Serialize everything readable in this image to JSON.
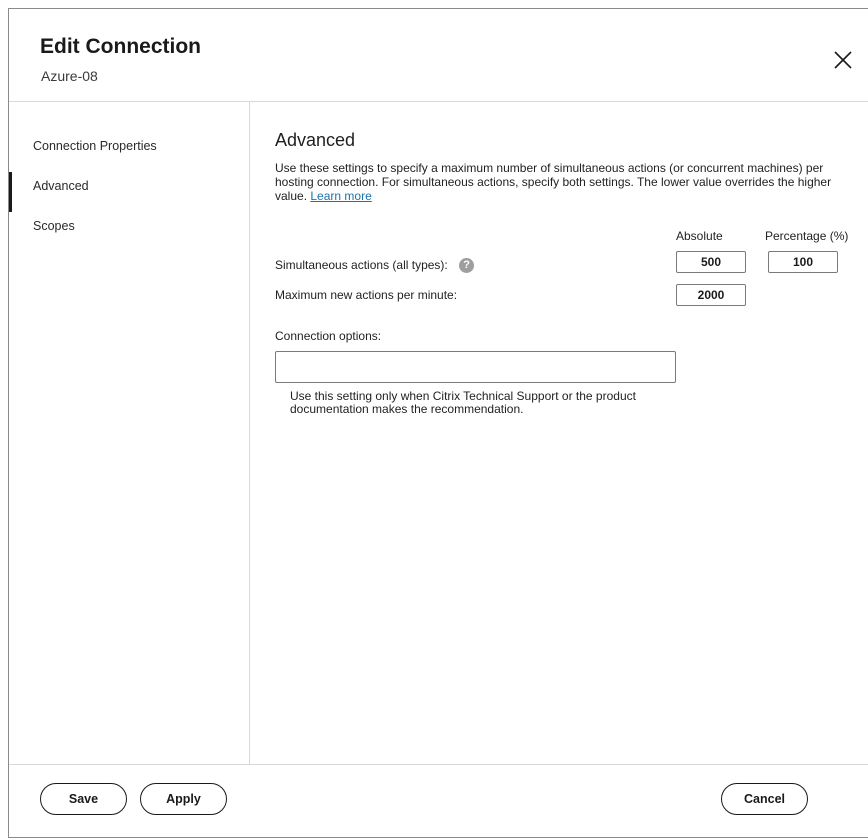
{
  "dialog": {
    "title": "Edit Connection",
    "subtitle": "Azure-08",
    "close_icon": "close-icon"
  },
  "sidebar": {
    "items": [
      {
        "label": "Connection Properties",
        "active": false
      },
      {
        "label": "Advanced",
        "active": true
      },
      {
        "label": "Scopes",
        "active": false
      }
    ]
  },
  "advanced": {
    "title": "Advanced",
    "description": "Use these settings to specify a maximum number of simultaneous actions (or concurrent machines) per hosting connection. For simultaneous actions, specify both settings. The lower value overrides the higher value.",
    "learn_more": "Learn more",
    "col_absolute": "Absolute",
    "col_percentage": "Percentage (%)",
    "simultaneous_label": "Simultaneous actions (all types):",
    "simultaneous_absolute": "500",
    "simultaneous_percentage": "100",
    "max_new_label": "Maximum new actions per minute:",
    "max_new_absolute": "2000",
    "connection_options_label": "Connection options:",
    "connection_options_value": "",
    "hint": "Use this setting only when Citrix Technical Support or the product documentation makes the recommendation."
  },
  "footer": {
    "save": "Save",
    "apply": "Apply",
    "cancel": "Cancel"
  },
  "colors": {
    "link": "#1a73a8",
    "help_icon": "#9e9e9e",
    "active_indicator": "#1a1a1a"
  }
}
